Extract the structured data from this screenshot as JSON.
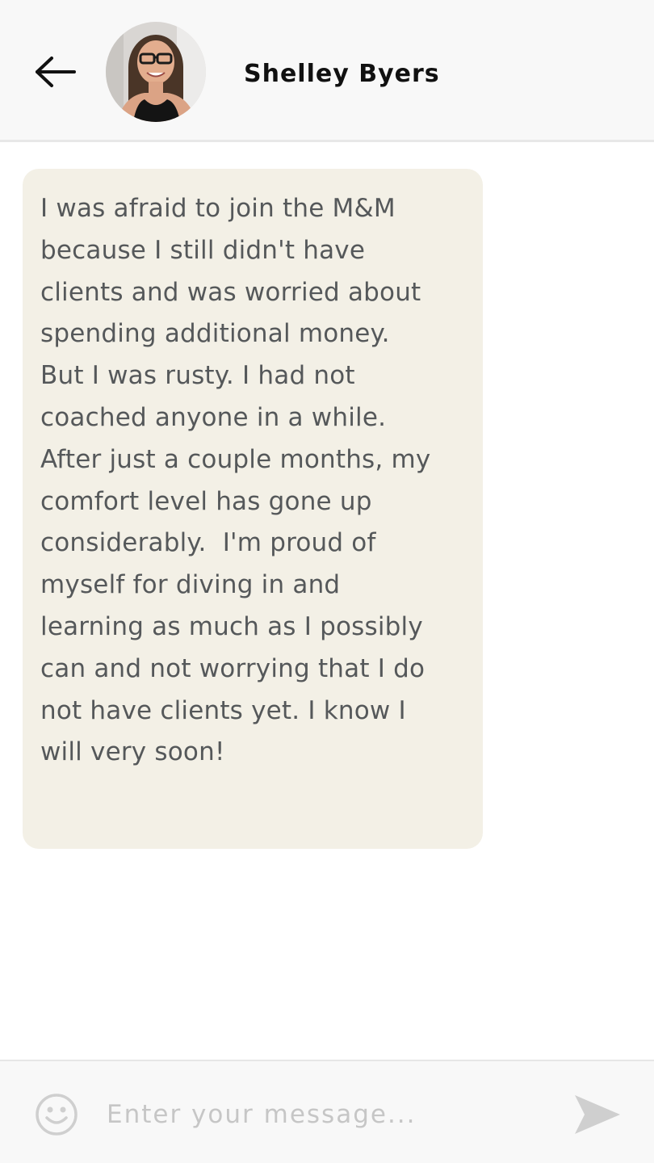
{
  "header": {
    "contact_name": "Shelley Byers",
    "back_icon": "arrow-left-icon",
    "avatar_icon": "contact-avatar"
  },
  "messages": [
    {
      "text": "I was afraid to join the M&M\nbecause I still didn't have\nclients and was worried about\nspending additional money.\nBut I was rusty. I had not\ncoached anyone in a while.\nAfter just a couple months, my\ncomfort level has gone up\nconsiderably.  I'm proud of\nmyself for diving in and\nlearning as much as I possibly\ncan and not worrying that I do\nnot have clients yet. I know I\nwill very soon!"
    }
  ],
  "composer": {
    "placeholder": "Enter your message...",
    "value": "",
    "emoji_icon": "smiley-icon",
    "send_icon": "send-icon"
  },
  "colors": {
    "header_bg": "#f8f8f8",
    "bubble_bg": "#f3f0e6",
    "bubble_text": "#55585a",
    "placeholder": "#c6c6c6",
    "icon_gray": "#cfcfcf"
  }
}
